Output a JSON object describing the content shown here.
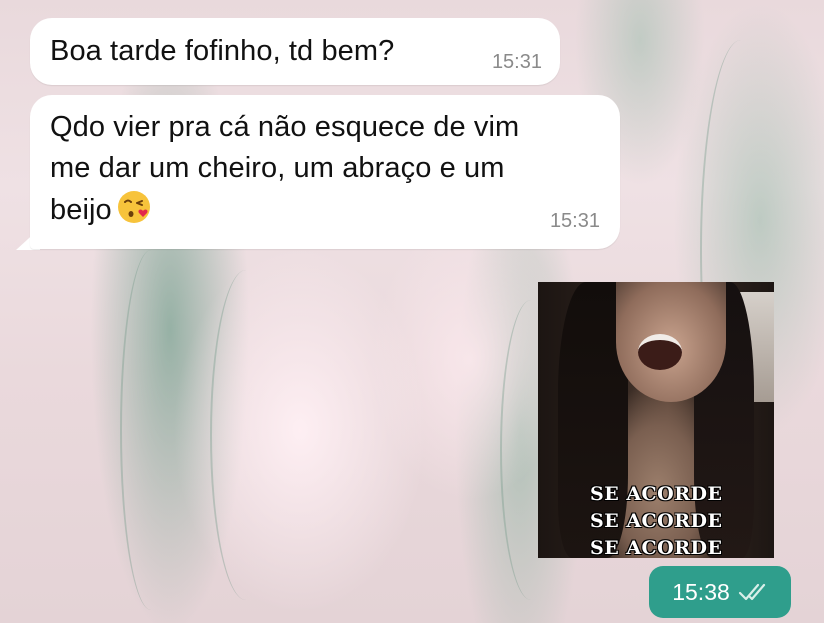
{
  "chat": {
    "messages": [
      {
        "direction": "incoming",
        "text": "Boa tarde fofinho, td bem?",
        "time": "15:31"
      },
      {
        "direction": "incoming",
        "line1": "Qdo vier pra cá não esquece de vim",
        "line2": "me dar um cheiro, um abraço e um",
        "line3": "beijo",
        "emoji": "face-blowing-a-kiss",
        "time": "15:31"
      },
      {
        "direction": "outgoing",
        "type": "gif",
        "caption": "SE ACORDE\nSE ACORDE\nSE ACORDE",
        "time": "15:38",
        "status": "read-double-check"
      }
    ]
  },
  "colors": {
    "incoming_bubble": "#ffffff",
    "outgoing_bubble": "#2f9e8c",
    "timestamp": "#8a8a8a"
  }
}
